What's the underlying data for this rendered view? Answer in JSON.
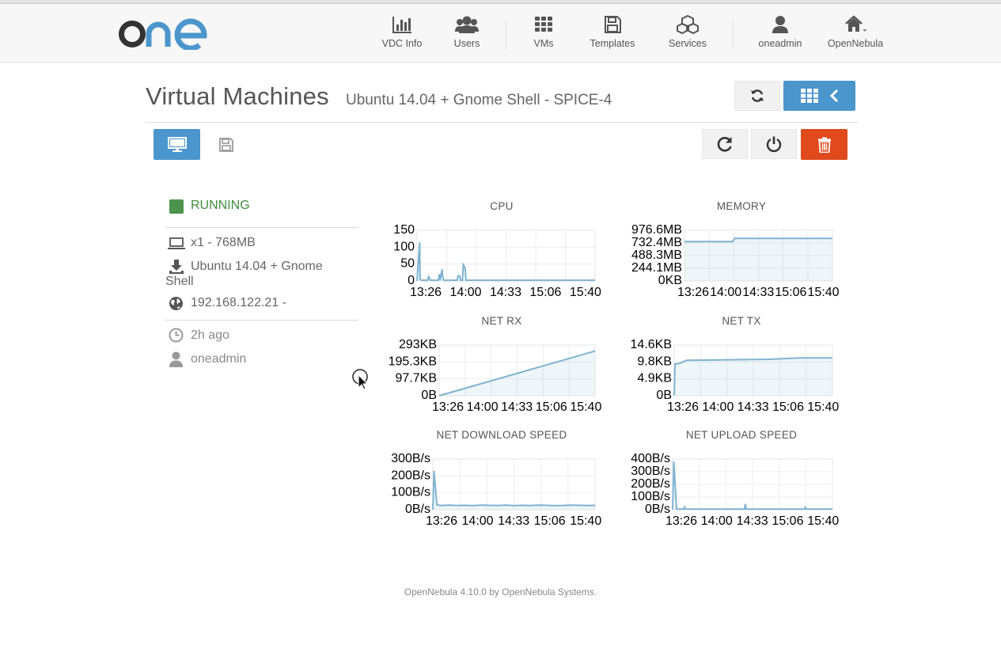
{
  "nav": {
    "items": [
      {
        "label": "VDC Info",
        "icon": "bar-chart-icon"
      },
      {
        "label": "Users",
        "icon": "users-icon"
      },
      {
        "label": "VMs",
        "icon": "grid-icon"
      },
      {
        "label": "Templates",
        "icon": "floppy-icon"
      },
      {
        "label": "Services",
        "icon": "cubes-icon"
      },
      {
        "label": "oneadmin",
        "icon": "user-icon"
      },
      {
        "label": "OpenNebula",
        "icon": "home-icon"
      }
    ]
  },
  "page": {
    "title": "Virtual Machines",
    "subtitle": "Ubuntu 14.04 + Gnome Shell - SPICE-4"
  },
  "vm": {
    "state": "RUNNING",
    "capacity": "x1 - 768MB",
    "image_line1": "Ubuntu 14.04 + Gnome",
    "image_line2": "Shell",
    "ip": "192.168.122.21 -",
    "age": "2h ago",
    "owner": "oneadmin"
  },
  "colors": {
    "accent": "#4b96cc",
    "danger": "#e04a1d",
    "running": "#4c934c",
    "series": "#7fb3d0"
  },
  "chart_data": [
    {
      "type": "line",
      "title": "CPU",
      "x_ticks": [
        "13:26",
        "14:00",
        "14:33",
        "15:06",
        "15:40"
      ],
      "y_ticks": [
        "150",
        "100",
        "50",
        "0"
      ],
      "ylim": [
        0,
        150
      ],
      "x": [
        0,
        0.3,
        0.35,
        0.5,
        1.2,
        1.3,
        1.5,
        1.6,
        2.4,
        2.5,
        2.6,
        2.8,
        2.9,
        3.0,
        4.5,
        4.6,
        4.8,
        4.9,
        5.0,
        5.1,
        5.2,
        5.4,
        5.5,
        5.6,
        5.7,
        6,
        10,
        20
      ],
      "values": [
        0,
        115,
        5,
        2,
        2,
        13,
        2,
        2,
        2,
        20,
        2,
        35,
        10,
        2,
        2,
        15,
        15,
        2,
        2,
        2,
        48,
        38,
        2,
        2,
        2,
        2,
        2,
        2
      ],
      "grid": true
    },
    {
      "type": "line",
      "title": "MEMORY",
      "x_ticks": [
        "13:26",
        "14:00",
        "14:33",
        "15:06",
        "15:40"
      ],
      "y_ticks": [
        "976.6MB",
        "732.4MB",
        "488.3MB",
        "244.1MB",
        "0KB"
      ],
      "ylim": [
        0,
        976.6
      ],
      "x": [
        0,
        6.5,
        6.8,
        20
      ],
      "values": [
        760,
        760,
        820,
        820
      ],
      "grid": true
    },
    {
      "type": "line",
      "title": "NET RX",
      "x_ticks": [
        "13:26",
        "14:00",
        "14:33",
        "15:06",
        "15:40"
      ],
      "y_ticks": [
        "293KB",
        "195.3KB",
        "97.7KB",
        "0B"
      ],
      "ylim": [
        0,
        293
      ],
      "x": [
        0,
        20
      ],
      "values": [
        0,
        258
      ],
      "grid": true
    },
    {
      "type": "line",
      "title": "NET TX",
      "x_ticks": [
        "13:26",
        "14:00",
        "14:33",
        "15:06",
        "15:40"
      ],
      "y_ticks": [
        "14.6KB",
        "9.8KB",
        "4.9KB",
        "0B"
      ],
      "ylim": [
        0,
        14.6
      ],
      "x": [
        0,
        0.1,
        0.5,
        1.6,
        12,
        16,
        20
      ],
      "values": [
        0,
        9.2,
        9.2,
        10.2,
        10.5,
        10.9,
        10.9
      ],
      "grid": true
    },
    {
      "type": "line",
      "title": "NET DOWNLOAD SPEED",
      "x_ticks": [
        "13:26",
        "14:00",
        "14:33",
        "15:06",
        "15:40"
      ],
      "y_ticks": [
        "300B/s",
        "200B/s",
        "100B/s",
        "0B/s"
      ],
      "ylim": [
        0,
        300
      ],
      "x": [
        0,
        0.15,
        0.5,
        1,
        2,
        3,
        4,
        5,
        6,
        7,
        8,
        9,
        10,
        11,
        12,
        13,
        14,
        15,
        16,
        17,
        18,
        19,
        20
      ],
      "values": [
        0,
        230,
        28,
        25,
        27,
        25,
        26,
        24,
        27,
        26,
        25,
        27,
        24,
        26,
        25,
        27,
        26,
        24,
        25,
        27,
        26,
        25,
        26
      ],
      "grid": true
    },
    {
      "type": "line",
      "title": "NET UPLOAD SPEED",
      "x_ticks": [
        "13:26",
        "14:00",
        "14:33",
        "15:06",
        "15:40"
      ],
      "y_ticks": [
        "400B/s",
        "300B/s",
        "200B/s",
        "100B/s",
        "0B/s"
      ],
      "ylim": [
        0,
        400
      ],
      "x": [
        0,
        0.15,
        0.5,
        1.4,
        1.5,
        1.6,
        9,
        9.1,
        9.2,
        16.5,
        16.6,
        16.7,
        20
      ],
      "values": [
        0,
        380,
        5,
        5,
        20,
        5,
        5,
        45,
        5,
        5,
        18,
        5,
        5
      ],
      "grid": true
    }
  ],
  "footer": {
    "text": "OpenNebula 4.10.0 by OpenNebula Systems."
  }
}
